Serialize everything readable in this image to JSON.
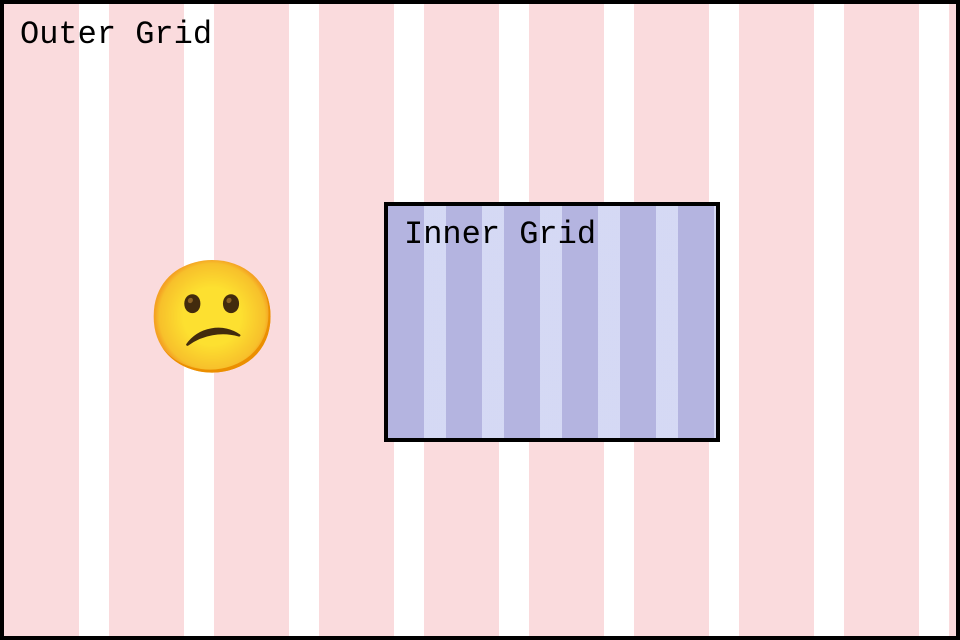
{
  "outer": {
    "label": "Outer Grid",
    "stripe_color": "#fadbdd",
    "gap_color": "#ffffff",
    "emoji": "😕"
  },
  "inner": {
    "label": "Inner Grid",
    "stripe_color": "#c0c0e4",
    "gap_color": "#d8dcf4"
  }
}
